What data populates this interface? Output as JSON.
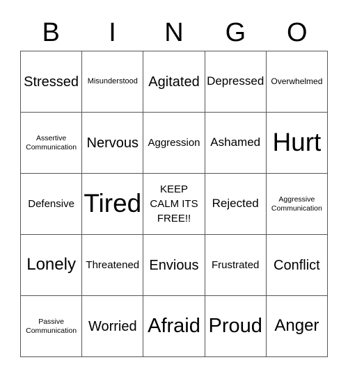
{
  "header": {
    "letters": [
      "B",
      "I",
      "N",
      "G",
      "O"
    ]
  },
  "board": {
    "rows": [
      [
        "Stressed",
        "Misunderstood",
        "Agitated",
        "Depressed",
        "Overwhelmed"
      ],
      [
        "Assertive Communication",
        "Nervous",
        "Aggression",
        "Ashamed",
        "Hurt"
      ],
      [
        "Defensive",
        "Tired",
        "KEEP CALM ITS FREE!!",
        "Rejected",
        "Aggressive Communication"
      ],
      [
        "Lonely",
        "Threatened",
        "Envious",
        "Frustrated",
        "Conflict"
      ],
      [
        "Passive Communication",
        "Worried",
        "Afraid",
        "Proud",
        "Anger"
      ]
    ]
  }
}
